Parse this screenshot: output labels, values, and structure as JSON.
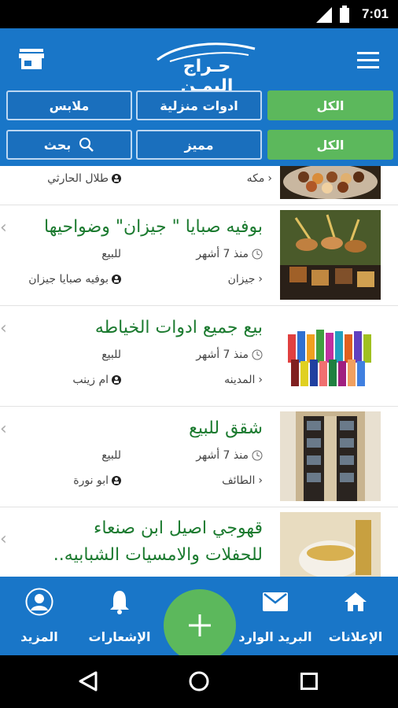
{
  "status_bar": {
    "time": "7:01"
  },
  "app_bar": {
    "logo_text": "حـراج اليمـن",
    "filters_row1": [
      "ملابس",
      "ادوات منزلية",
      "الكل"
    ],
    "filters_row2": [
      "بحث",
      "مميز",
      "الكل"
    ]
  },
  "partial_item": {
    "city": "مكه",
    "user": "طلال الحارثي"
  },
  "listings": [
    {
      "title": "بوفيه صبايا \" جيزان\" وضواحيها",
      "time": "منذ 7 أشهر",
      "type": "للبيع",
      "city": "جيزان",
      "user": "بوفيه صبايا جيزان"
    },
    {
      "title": "بيع جميع ادوات الخياطه",
      "time": "منذ 7 أشهر",
      "type": "للبيع",
      "city": "المدينه",
      "user": "ام زينب"
    },
    {
      "title": "شقق للبيع",
      "time": "منذ 7 أشهر",
      "type": "للبيع",
      "city": "الطائف",
      "user": "ابو نورة"
    },
    {
      "title_line1": "قهوجي اصيل ابن صنعاء",
      "title_line2": "للحفلات والامسيات الشبابيه.."
    }
  ],
  "bottom_nav": {
    "ads": "الإعلانات",
    "inbox": "البريد الوارد",
    "notifications": "الإشعارات",
    "more": "المزيد"
  },
  "colors": {
    "primary": "#1976c8",
    "accent_green": "#5cb85c",
    "title_green": "#1b7a2f"
  }
}
